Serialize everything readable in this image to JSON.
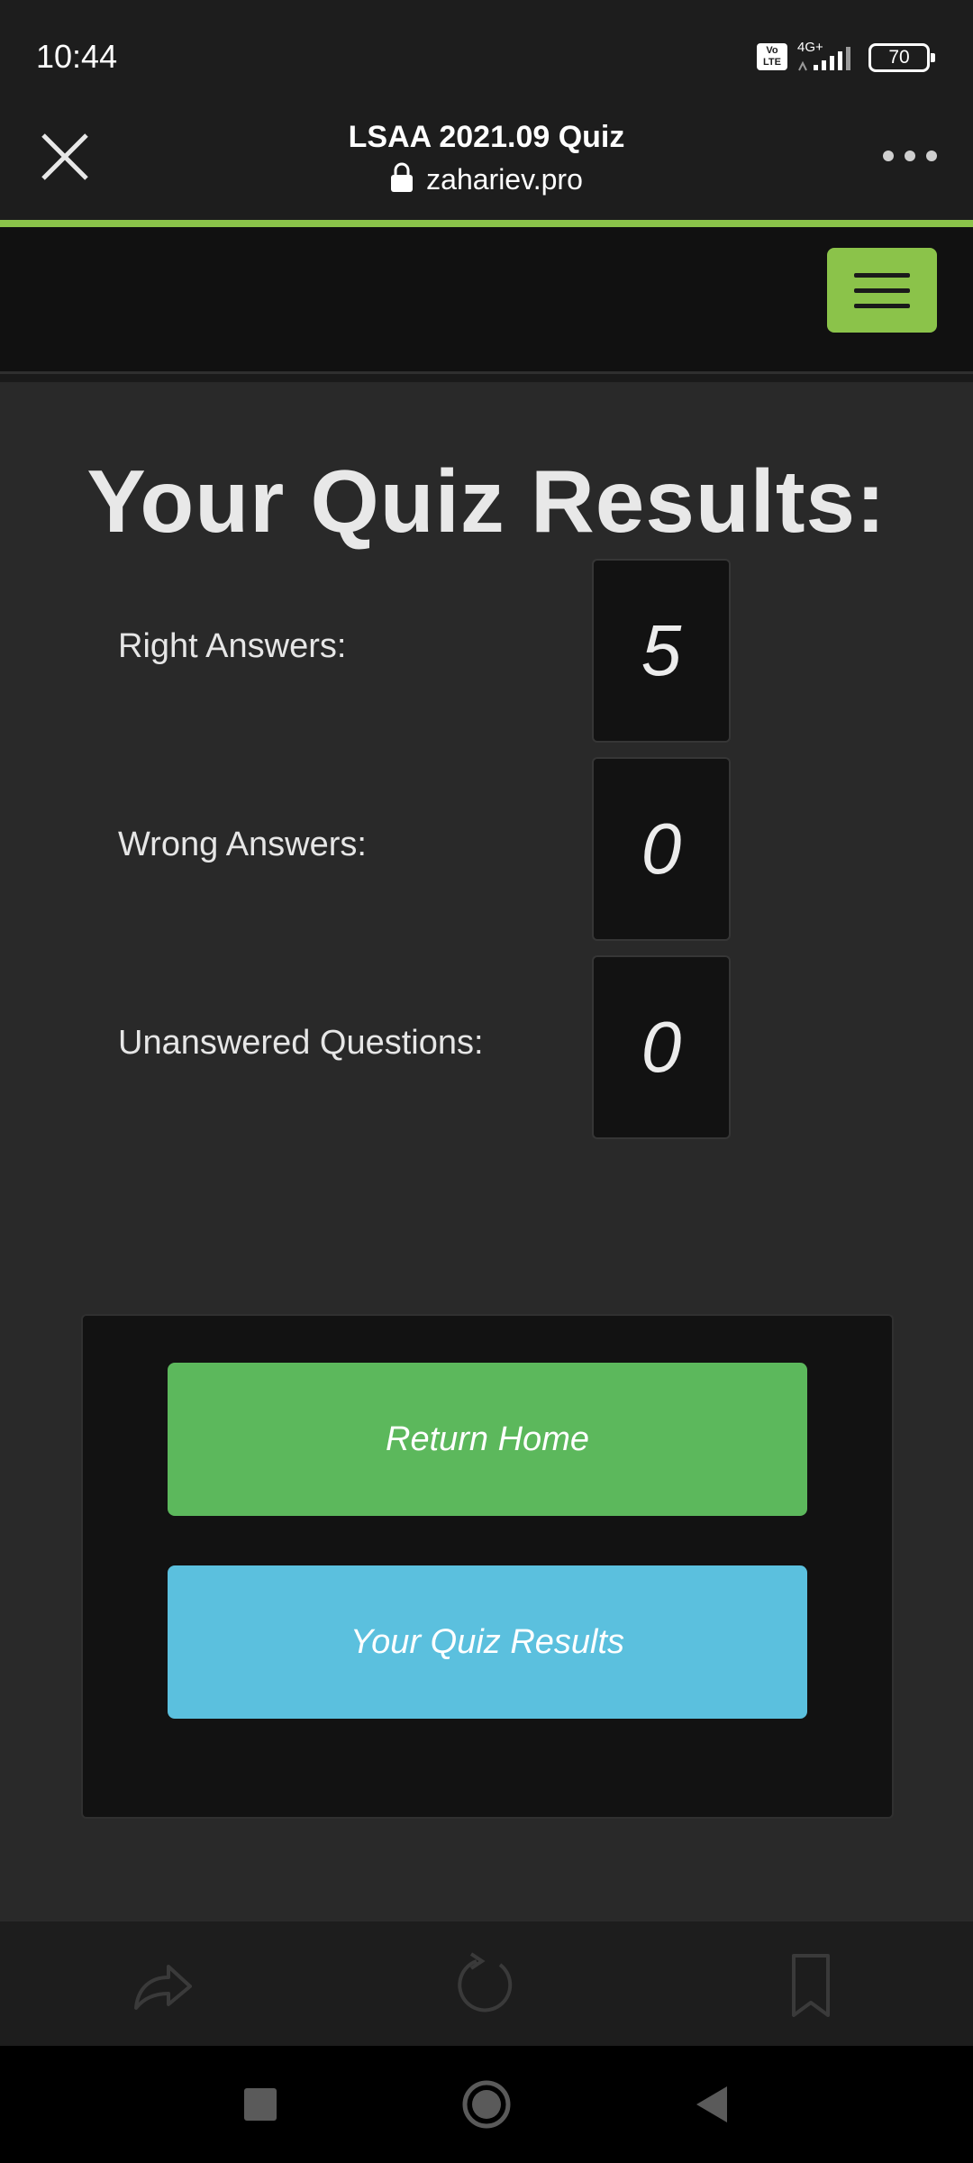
{
  "status_bar": {
    "time": "10:44",
    "volte": "Vo LTE",
    "network": "4G+",
    "battery": "70"
  },
  "browser": {
    "title": "LSAA 2021.09 Quiz",
    "url": "zahariev.pro",
    "accent_color": "#8bc34a"
  },
  "main": {
    "heading": "Your Quiz Results:",
    "results": [
      {
        "label": "Right Answers:",
        "value": "5"
      },
      {
        "label": "Wrong Answers:",
        "value": "0"
      },
      {
        "label": "Unanswered Questions:",
        "value": "0"
      }
    ],
    "buttons": {
      "return_home": "Return Home",
      "quiz_results": "Your Quiz Results"
    },
    "button_colors": {
      "return_home": "#5cb85c",
      "quiz_results": "#5bc0de"
    }
  },
  "toolbar_icons": [
    "share-icon",
    "reload-icon",
    "bookmark-icon"
  ],
  "nav_icons": [
    "recents-square-icon",
    "home-circle-icon",
    "back-triangle-icon"
  ]
}
